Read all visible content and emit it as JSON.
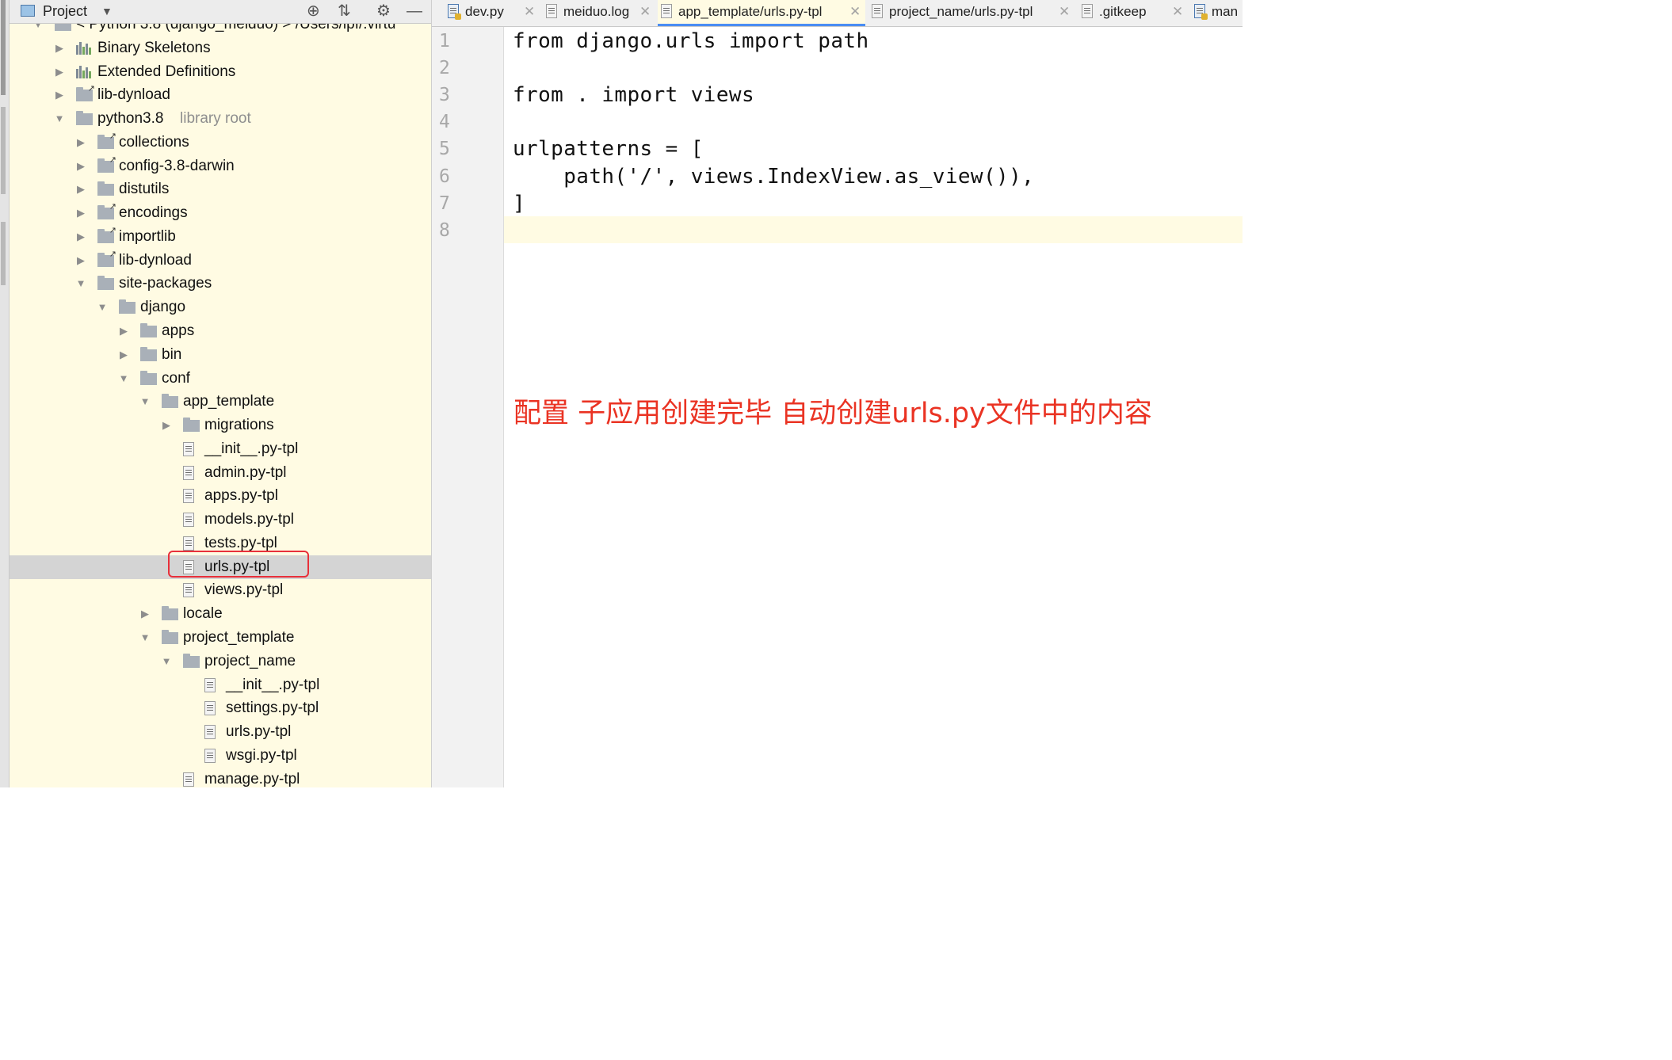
{
  "project_panel": {
    "title": "Project",
    "header_icons": [
      "target-icon",
      "collapse-icon",
      "gear-icon",
      "minimize-icon"
    ],
    "tree": [
      {
        "label": "< Python 3.8 (django_meiduo) > /Users/lpf/.virtu",
        "kind": "sdk",
        "expanded": true
      },
      {
        "label": "Binary Skeletons",
        "kind": "bars",
        "expanded": false
      },
      {
        "label": "Extended Definitions",
        "kind": "bars",
        "expanded": false
      },
      {
        "label": "lib-dynload",
        "kind": "folder-link",
        "expanded": false
      },
      {
        "label": "python3.8",
        "extra": "library root",
        "kind": "folder",
        "expanded": true
      },
      {
        "label": "collections",
        "kind": "folder-link",
        "expanded": false
      },
      {
        "label": "config-3.8-darwin",
        "kind": "folder-link",
        "expanded": false
      },
      {
        "label": "distutils",
        "kind": "folder",
        "expanded": false
      },
      {
        "label": "encodings",
        "kind": "folder-link",
        "expanded": false
      },
      {
        "label": "importlib",
        "kind": "folder-link",
        "expanded": false
      },
      {
        "label": "lib-dynload",
        "kind": "folder-link",
        "expanded": false
      },
      {
        "label": "site-packages",
        "kind": "folder",
        "expanded": true
      },
      {
        "label": "django",
        "kind": "folder",
        "expanded": true
      },
      {
        "label": "apps",
        "kind": "folder",
        "expanded": false
      },
      {
        "label": "bin",
        "kind": "folder",
        "expanded": false
      },
      {
        "label": "conf",
        "kind": "folder",
        "expanded": true
      },
      {
        "label": "app_template",
        "kind": "folder",
        "expanded": true
      },
      {
        "label": "migrations",
        "kind": "folder",
        "expanded": false
      },
      {
        "label": "__init__.py-tpl",
        "kind": "file"
      },
      {
        "label": "admin.py-tpl",
        "kind": "file"
      },
      {
        "label": "apps.py-tpl",
        "kind": "file"
      },
      {
        "label": "models.py-tpl",
        "kind": "file"
      },
      {
        "label": "tests.py-tpl",
        "kind": "file"
      },
      {
        "label": "urls.py-tpl",
        "kind": "file",
        "selected": true
      },
      {
        "label": "views.py-tpl",
        "kind": "file"
      },
      {
        "label": "locale",
        "kind": "folder",
        "expanded": false
      },
      {
        "label": "project_template",
        "kind": "folder",
        "expanded": true
      },
      {
        "label": "project_name",
        "kind": "folder",
        "expanded": true
      },
      {
        "label": "__init__.py-tpl",
        "kind": "file"
      },
      {
        "label": "settings.py-tpl",
        "kind": "file"
      },
      {
        "label": "urls.py-tpl",
        "kind": "file"
      },
      {
        "label": "wsgi.py-tpl",
        "kind": "file"
      },
      {
        "label": "manage.py-tpl",
        "kind": "file"
      }
    ]
  },
  "tabs": [
    {
      "label": "dev.py",
      "icon": "python-file-icon"
    },
    {
      "label": "meiduo.log",
      "icon": "text-file-icon"
    },
    {
      "label": "app_template/urls.py-tpl",
      "icon": "text-file-icon",
      "active": true
    },
    {
      "label": "project_name/urls.py-tpl",
      "icon": "text-file-icon"
    },
    {
      "label": ".gitkeep",
      "icon": "text-file-icon"
    },
    {
      "label": "man",
      "icon": "python-file-icon"
    }
  ],
  "editor": {
    "line_numbers": [
      "1",
      "2",
      "3",
      "4",
      "5",
      "6",
      "7",
      "8"
    ],
    "lines": [
      "from django.urls import path",
      "",
      "from . import views",
      "",
      "urlpatterns = [",
      "    path('/', views.IndexView.as_view()),",
      "]",
      ""
    ],
    "current_line": 8
  },
  "annotation": "配置 子应用创建完毕 自动创建urls.py文件中的内容",
  "colors": {
    "panel_bg": "#fffbe3",
    "selected_row": "#d4d4d4",
    "highlight_box": "#e8303a",
    "annotation": "#ea3323",
    "active_tab_underline": "#4a8df3"
  }
}
